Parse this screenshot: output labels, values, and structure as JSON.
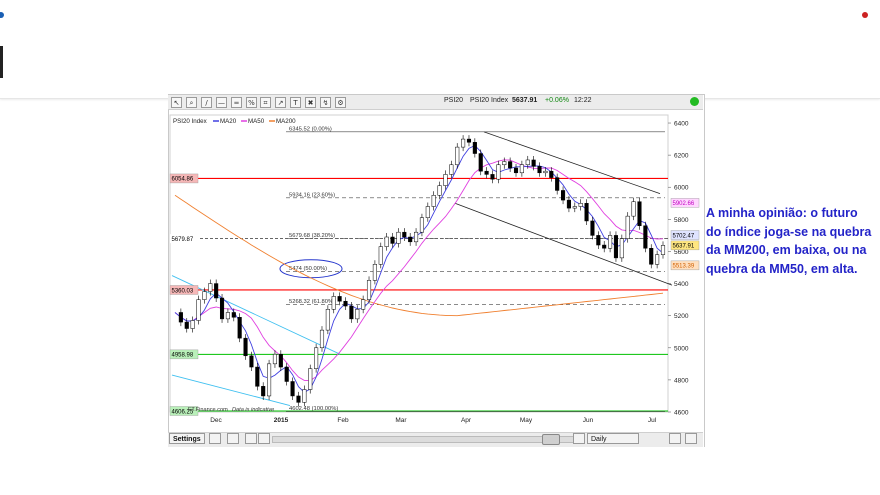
{
  "toolbar": {
    "symbol": "PSI20",
    "index_name": "PSI20 Index",
    "last_price": "5637.91",
    "change": "+0.06%",
    "time": "12:22"
  },
  "bottom_toolbar": {
    "settings_label": "Settings",
    "interval_label": "Daily"
  },
  "annotation": {
    "text": "A minha opinião: o futuro do índice joga-se na quebra da MM200, em baixa, ou na quebra da MM50, em alta."
  },
  "colors": {
    "up_candle": "#ffffff",
    "down_candle": "#000000",
    "ma20": "#4040e0",
    "ma50": "#e040e0",
    "ma200": "#f08030",
    "resistance_red": "#ff0000",
    "support_green": "#00c000",
    "trendline_cyan": "#40c0f0",
    "annotation_text": "#2323c8"
  },
  "chart_data": {
    "type": "line",
    "title": "",
    "legend": {
      "index_label": "PSI20 Index",
      "placement": "top-left",
      "series": [
        "MA20",
        "MA50",
        "MA200"
      ]
    },
    "x_ticks": [
      "Dec",
      "2015",
      "Jan",
      "Feb",
      "Mar",
      "Apr",
      "May",
      "Jun",
      "Jul"
    ],
    "ylim": [
      4600,
      6450
    ],
    "y_ticks": [
      6400,
      6200,
      6000,
      5800,
      5600,
      5400,
      5200,
      5000,
      4800,
      4600
    ],
    "price_labels": [
      {
        "value": 6054.86,
        "text": "6054.86",
        "side": "left",
        "color": "red"
      },
      {
        "value": 5360.03,
        "text": "5360.03",
        "side": "left",
        "color": "red"
      },
      {
        "value": 4958.98,
        "text": "4958.98",
        "side": "left",
        "color": "green"
      },
      {
        "value": 4606.25,
        "text": "4606.25",
        "side": "left",
        "color": "green"
      },
      {
        "value": 5679.87,
        "text": "5679.87",
        "side": "left",
        "color": "plain"
      },
      {
        "value": 5902.66,
        "text": "5902.66",
        "side": "right",
        "color": "magenta"
      },
      {
        "value": 5702.47,
        "text": "5702.47",
        "side": "right",
        "color": "blue"
      },
      {
        "value": 5637.91,
        "text": "5637.91",
        "side": "right",
        "color": "yellow"
      },
      {
        "value": 5513.39,
        "text": "5513.39",
        "side": "right",
        "color": "orange"
      }
    ],
    "horizontal_lines": [
      {
        "name": "resistance-6054",
        "value": 6054.86,
        "color": "red",
        "style": "solid"
      },
      {
        "name": "support-5360",
        "value": 5360.03,
        "color": "red",
        "style": "solid"
      },
      {
        "name": "support-4958",
        "value": 4958.98,
        "color": "green",
        "style": "solid"
      },
      {
        "name": "support-4606",
        "value": 4606.25,
        "color": "green",
        "style": "solid"
      },
      {
        "name": "level-5679",
        "value": 5679.87,
        "color": "black",
        "style": "dashed"
      }
    ],
    "fibonacci": [
      {
        "value": 6345.52,
        "label": "6345.52 (0.00%)"
      },
      {
        "value": 5934.16,
        "label": "5934.16 (23.60%)"
      },
      {
        "value": 5679.68,
        "label": "5679.68 (38.20%)"
      },
      {
        "value": 5474,
        "label": "5474 (50.00%)"
      },
      {
        "value": 5268.32,
        "label": "5268.32 (61.80%)"
      },
      {
        "value": 4602.48,
        "label": "4602.48 (100.00%)"
      }
    ],
    "source_text": "FT.Finance.com",
    "disclaimer_text": "Data is indicative",
    "price_series": [
      5220,
      5160,
      5120,
      5170,
      5300,
      5350,
      5400,
      5310,
      5180,
      5220,
      5190,
      5060,
      4950,
      4880,
      4760,
      4700,
      4900,
      4960,
      4880,
      4790,
      4700,
      4660,
      4740,
      4870,
      5000,
      5110,
      5240,
      5320,
      5290,
      5260,
      5180,
      5240,
      5300,
      5420,
      5520,
      5630,
      5690,
      5650,
      5720,
      5690,
      5660,
      5720,
      5810,
      5880,
      5950,
      6010,
      6080,
      6140,
      6250,
      6300,
      6280,
      6210,
      6100,
      6080,
      6050,
      6140,
      6160,
      6120,
      6090,
      6140,
      6170,
      6130,
      6090,
      6100,
      6060,
      5980,
      5920,
      5870,
      5880,
      5900,
      5790,
      5700,
      5640,
      5620,
      5700,
      5560,
      5680,
      5820,
      5910,
      5760,
      5620,
      5520,
      5580,
      5637.91
    ]
  }
}
